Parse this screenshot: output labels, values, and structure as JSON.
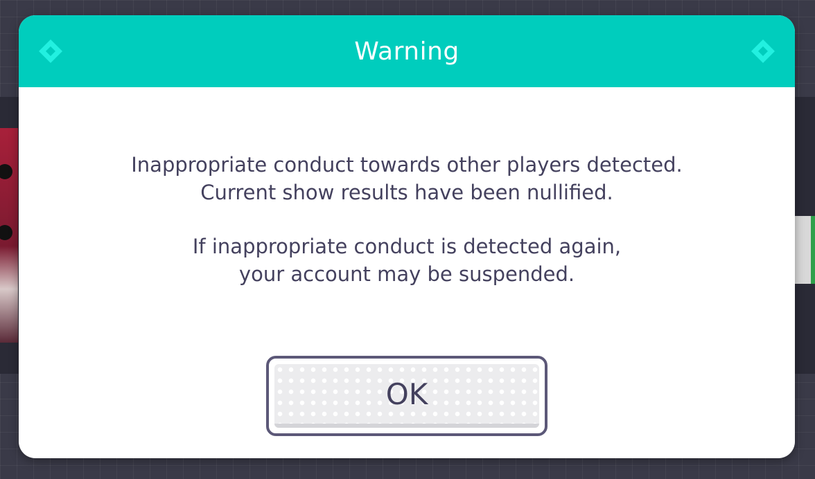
{
  "dialog": {
    "title": "Warning",
    "message_paragraphs": [
      [
        "Inappropriate conduct towards other players detected.",
        "Current show results have been nullified."
      ],
      [
        "If inappropriate conduct is detected again,",
        "your account may be suspended."
      ]
    ],
    "ok_label": "OK"
  },
  "icons": {
    "header_left": "diamond-icon",
    "header_right": "diamond-icon"
  },
  "colors": {
    "header": "#00cdbd",
    "accent_icon": "#22f0e0",
    "text": "#44415e",
    "button_border": "#5c5878",
    "backdrop": "#3a3a48"
  }
}
